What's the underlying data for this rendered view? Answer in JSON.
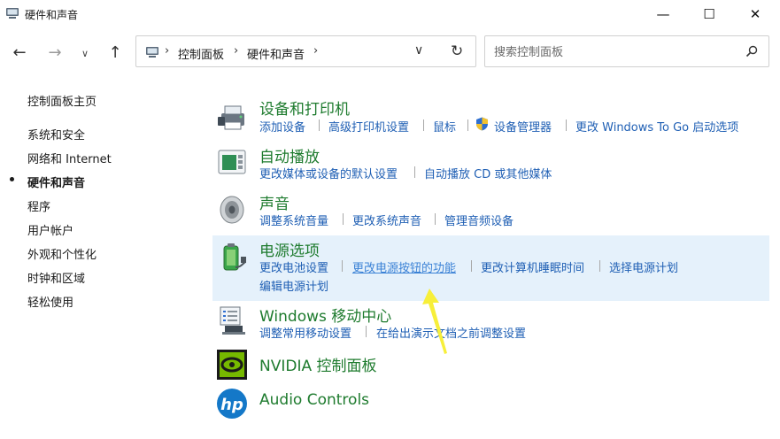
{
  "window": {
    "title": "硬件和声音",
    "minimize": "—",
    "maximize": "☐",
    "close": "✕"
  },
  "nav": {
    "back": "←",
    "forward": "→",
    "recent": "∨",
    "up": "↑"
  },
  "address": {
    "crumbs": [
      "控制面板",
      "硬件和声音"
    ],
    "sep": "›",
    "dropdown": "∨",
    "refresh": "↻"
  },
  "search": {
    "placeholder": "搜索控制面板"
  },
  "sidebar": {
    "items": [
      {
        "label": "控制面板主页"
      },
      {
        "label": "系统和安全"
      },
      {
        "label": "网络和 Internet"
      },
      {
        "label": "硬件和声音",
        "active": true
      },
      {
        "label": "程序"
      },
      {
        "label": "用户帐户"
      },
      {
        "label": "外观和个性化"
      },
      {
        "label": "时钟和区域"
      },
      {
        "label": "轻松使用"
      }
    ]
  },
  "categories": {
    "devices": {
      "title": "设备和打印机",
      "icon": "printer-icon",
      "links": [
        "添加设备",
        "高级打印机设置",
        "鼠标",
        "设备管理器",
        "更改 Windows To Go 启动选项"
      ]
    },
    "autoplay": {
      "title": "自动播放",
      "icon": "autoplay-icon",
      "links": [
        "更改媒体或设备的默认设置",
        "自动播放 CD 或其他媒体"
      ]
    },
    "sound": {
      "title": "声音",
      "icon": "speaker-icon",
      "links": [
        "调整系统音量",
        "更改系统声音",
        "管理音频设备"
      ]
    },
    "power": {
      "title": "电源选项",
      "icon": "battery-icon",
      "links": [
        "更改电池设置",
        "更改电源按钮的功能",
        "更改计算机睡眠时间",
        "选择电源计划",
        "编辑电源计划"
      ]
    },
    "mobility": {
      "title": "Windows 移动中心",
      "icon": "mobility-center-icon",
      "links": [
        "调整常用移动设置",
        "在给出演示文档之前调整设置"
      ]
    },
    "nvidia": {
      "title": "NVIDIA 控制面板",
      "icon": "nvidia-icon"
    },
    "audio": {
      "title": "Audio Controls",
      "icon": "hp-icon",
      "logo_text": "hp"
    }
  },
  "colors": {
    "title_green": "#1e7b2e",
    "link_blue": "#1f5fb4",
    "highlight": "#e5f1fb",
    "arrow": "#f7ef3a"
  }
}
